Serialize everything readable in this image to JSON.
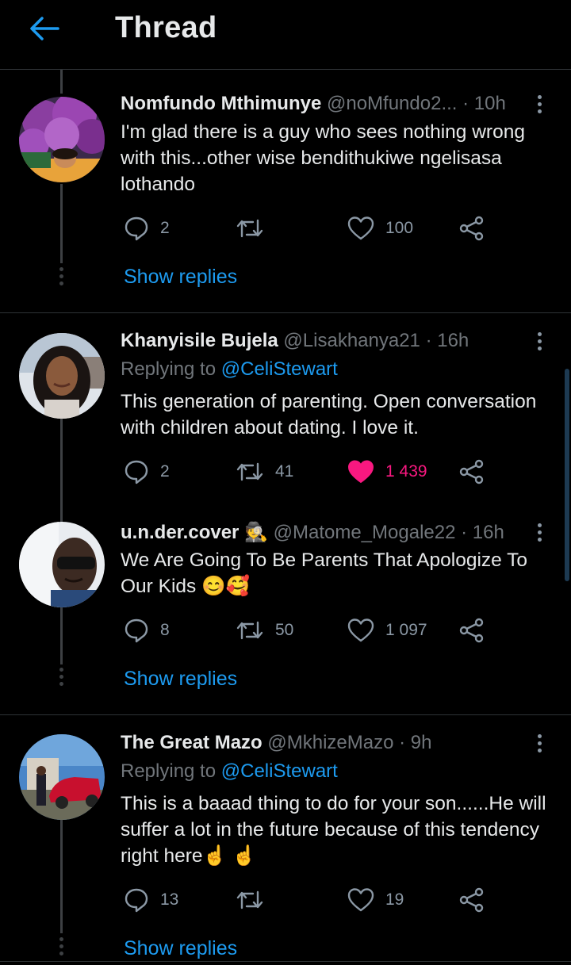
{
  "header": {
    "title": "Thread",
    "back_icon": "arrow-left-icon"
  },
  "colors": {
    "accent": "#1d9bf0",
    "like": "#f91880",
    "muted": "#71767b",
    "background": "#000000"
  },
  "tweets": [
    {
      "name": "Nomfundo Mthimunye",
      "handle": "@noMfundo2...",
      "time": "· 10h",
      "replying_label": "",
      "replying_handle": "",
      "text": "I'm glad there is a guy who sees nothing wrong with this...other wise bendithukiwe ngelisasa lothando",
      "replies": "2",
      "retweets": "",
      "likes": "100",
      "liked": false,
      "show_replies": "Show replies"
    },
    {
      "name": "Khanyisile Bujela",
      "handle": "@Lisakhanya21",
      "time": "· 16h",
      "replying_label": "Replying to",
      "replying_handle": "@CeliStewart",
      "text": "This generation of parenting. Open conversation with children about dating. I love it.",
      "replies": "2",
      "retweets": "41",
      "likes": "1 439",
      "liked": true,
      "show_replies": ""
    },
    {
      "name": "u.n.der.cover",
      "name_emoji": "🕵",
      "handle": "@Matome_Mogale22",
      "time": "· 16h",
      "replying_label": "",
      "replying_handle": "",
      "text": "We Are Going To Be Parents That Apologize To Our Kids 😊🥰",
      "replies": "8",
      "retweets": "50",
      "likes": "1 097",
      "liked": false,
      "show_replies": "Show replies"
    },
    {
      "name": "The Great Mazo",
      "handle": "@MkhizeMazo",
      "time": "· 9h",
      "replying_label": "Replying to",
      "replying_handle": "@CeliStewart",
      "text": "This is a baaad thing to do for your son......He will suffer a lot in the future because of this tendency right here☝️ ☝️",
      "replies": "13",
      "retweets": "",
      "likes": "19",
      "liked": false,
      "show_replies": "Show replies"
    }
  ]
}
